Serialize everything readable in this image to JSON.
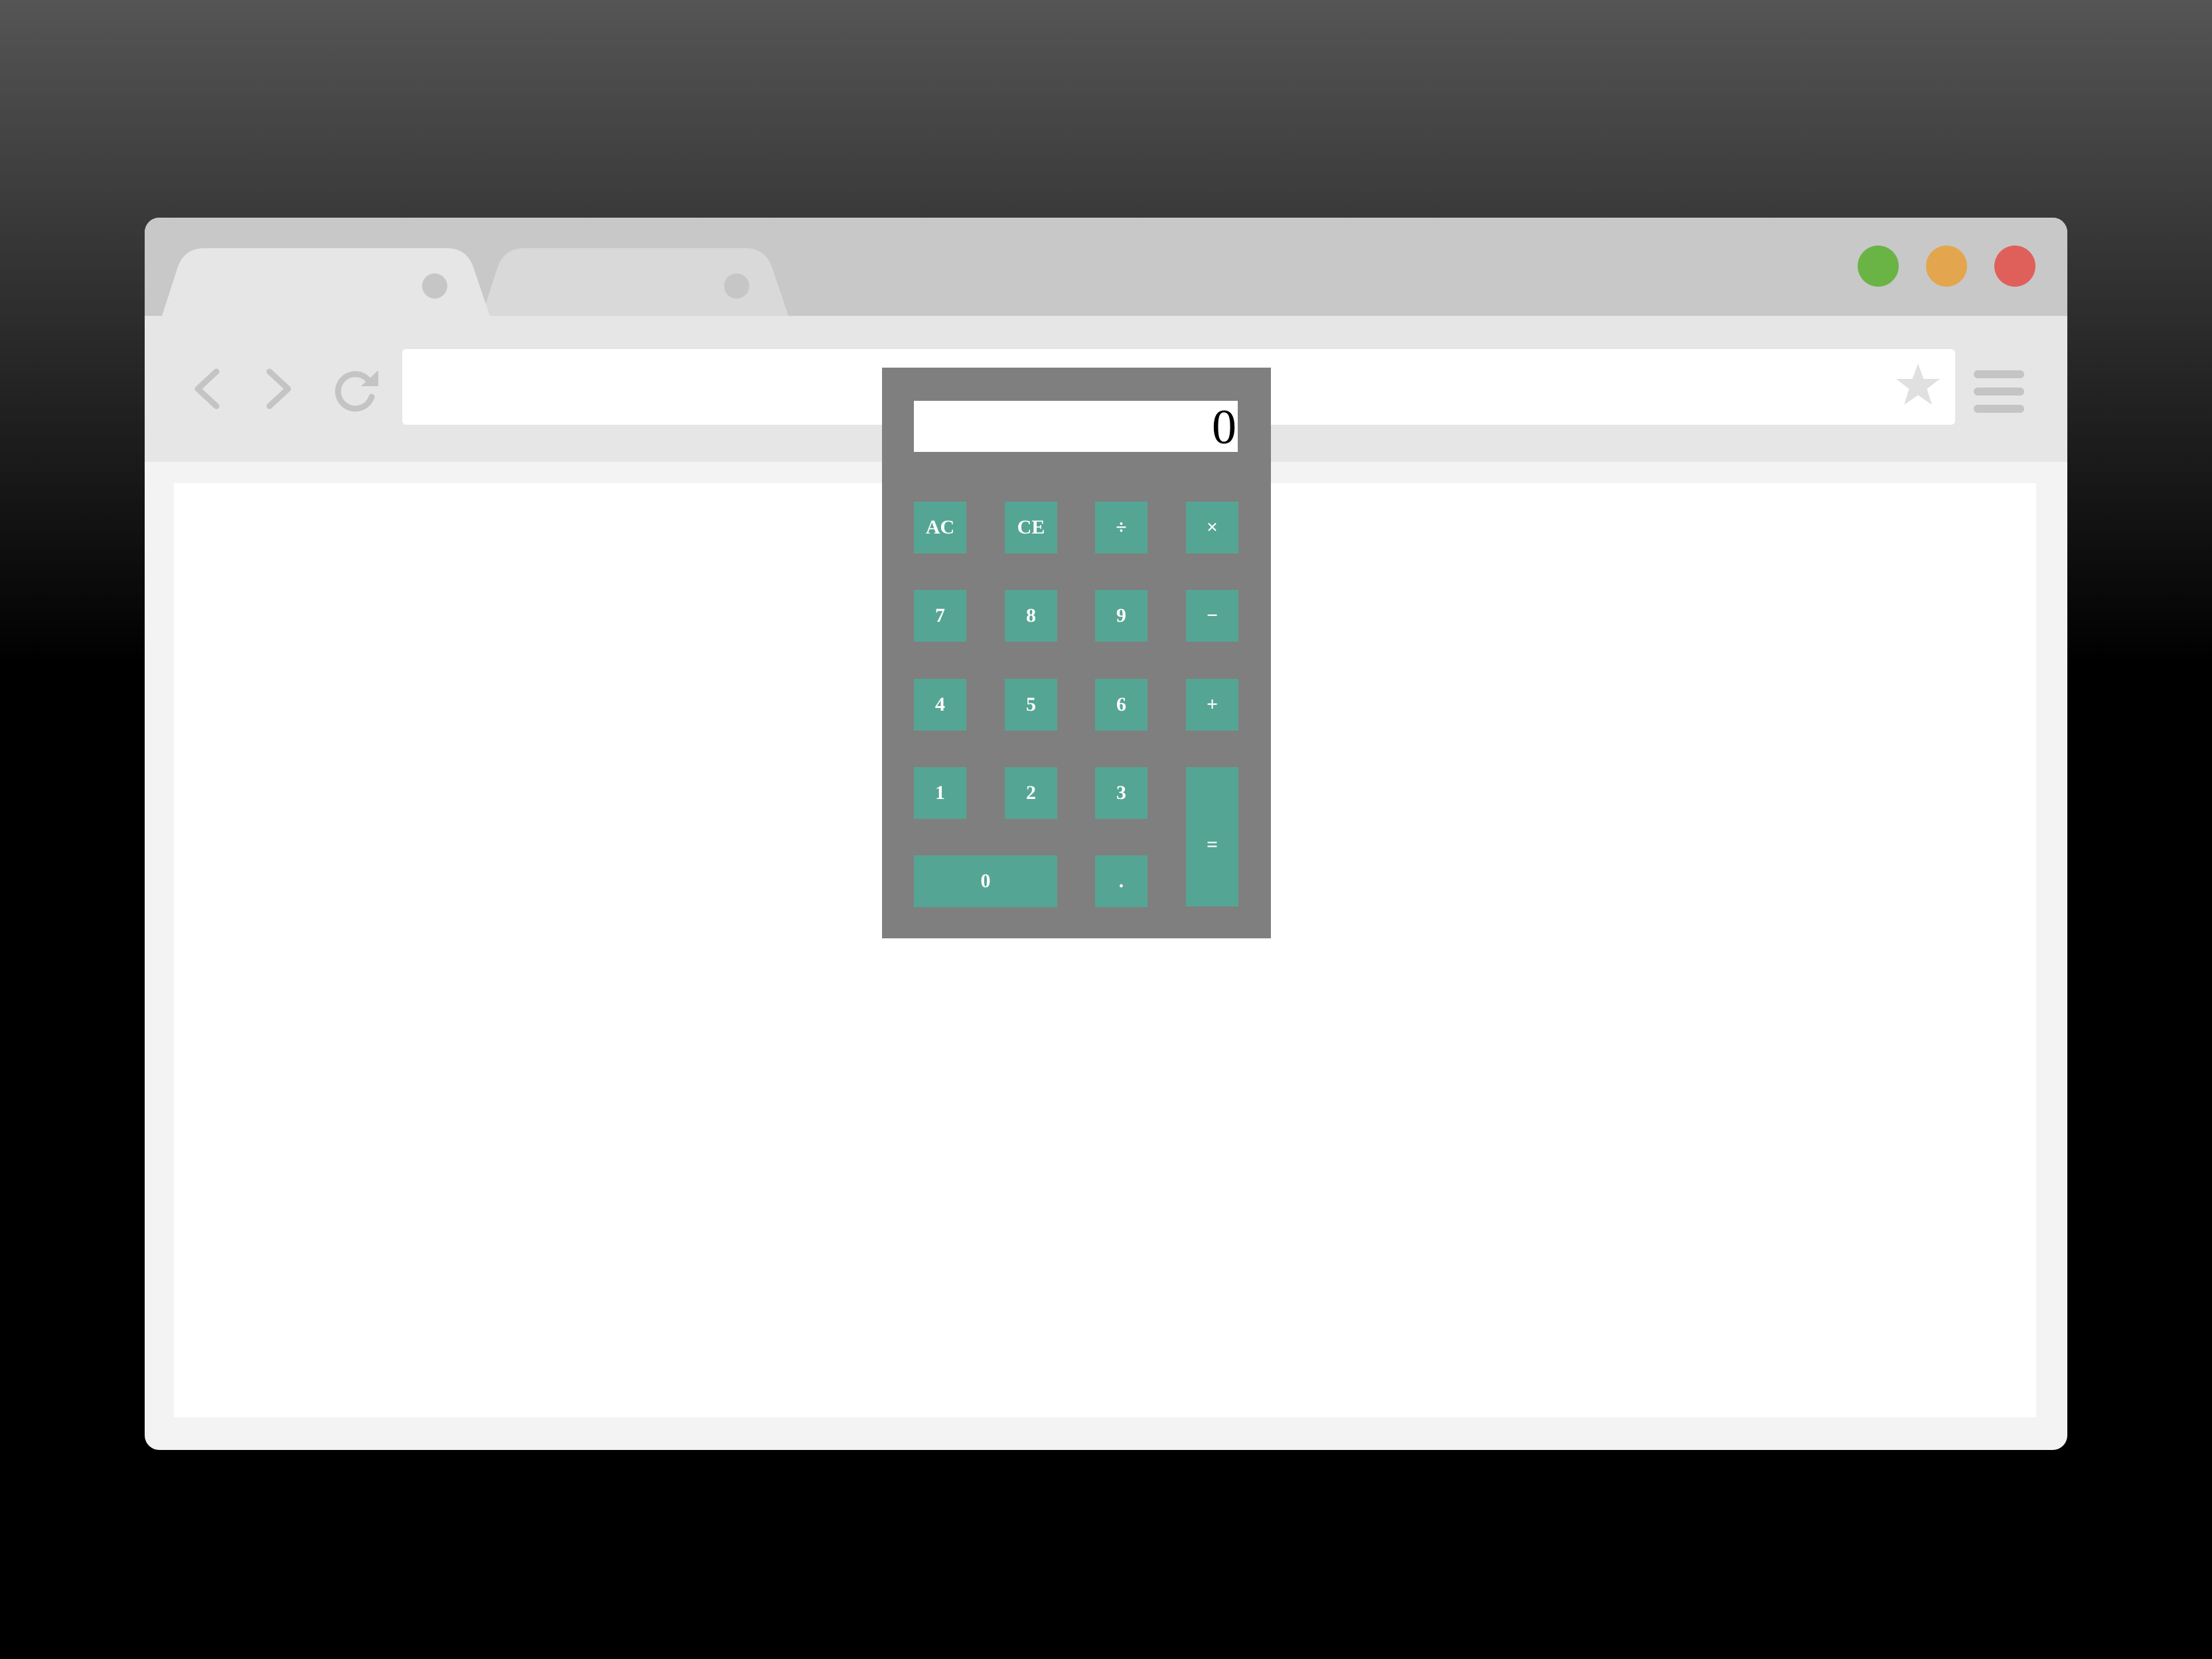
{
  "browser": {
    "tabs": [
      {
        "title": "",
        "active": true
      },
      {
        "title": "",
        "active": false
      }
    ],
    "window_controls": {
      "colors": {
        "green": "#6ab446",
        "orange": "#e3a64f",
        "red": "#df605b"
      }
    },
    "address_bar": {
      "value": "",
      "placeholder": ""
    },
    "icons": {
      "back": "chevron-left-icon",
      "forward": "chevron-right-icon",
      "reload": "reload-icon",
      "bookmark": "star-icon",
      "menu": "hamburger-menu-icon"
    }
  },
  "calculator": {
    "display": "0",
    "colors": {
      "body": "#7f7f7f",
      "key": "#55a594",
      "key_text": "#ffffff"
    },
    "keys": {
      "ac": "AC",
      "ce": "CE",
      "divide": "÷",
      "multiply": "×",
      "seven": "7",
      "eight": "8",
      "nine": "9",
      "subtract": "−",
      "four": "4",
      "five": "5",
      "six": "6",
      "add": "+",
      "one": "1",
      "two": "2",
      "three": "3",
      "equals": "=",
      "zero": "0",
      "decimal": "."
    }
  }
}
